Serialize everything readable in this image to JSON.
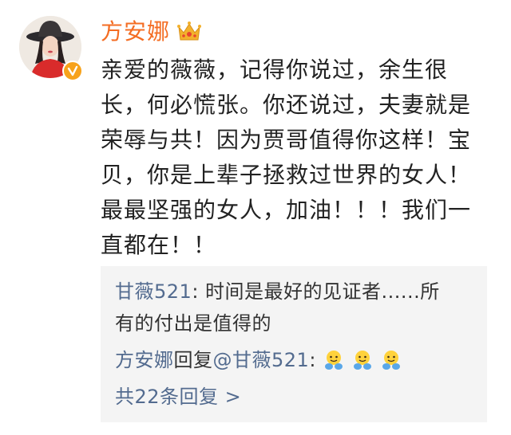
{
  "comment": {
    "author": "方安娜",
    "lines": [
      "亲爱的薇薇，记得你说过，余生很",
      "长，何必慌张。你还说过，夫妻就是",
      "荣辱与共！因为贾哥值得你这样！宝",
      "贝，你是上辈子拯救过世界的女人！",
      "最最坚强的女人，加油！！！我们一",
      "直都在！！"
    ]
  },
  "replies": {
    "first": {
      "name": "甘薇521",
      "text_line1": ": 时间是最好的见证者......所",
      "text_line2": "有的付出是值得的"
    },
    "second": {
      "name": "方安娜",
      "middle": "回复",
      "mention": "@甘薇521",
      "colon": ":"
    },
    "more": "共22条回复 >"
  },
  "icons": {
    "crown": "crown-icon",
    "verified": "verified-badge-icon",
    "emoji": "hug-emoji-icon"
  },
  "colors": {
    "author_name": "#f46d23",
    "link_blue": "#536b8f",
    "reply_background": "#f4f4f4",
    "verified_badge": "#f7a21b",
    "crown": "#f3b12d"
  }
}
